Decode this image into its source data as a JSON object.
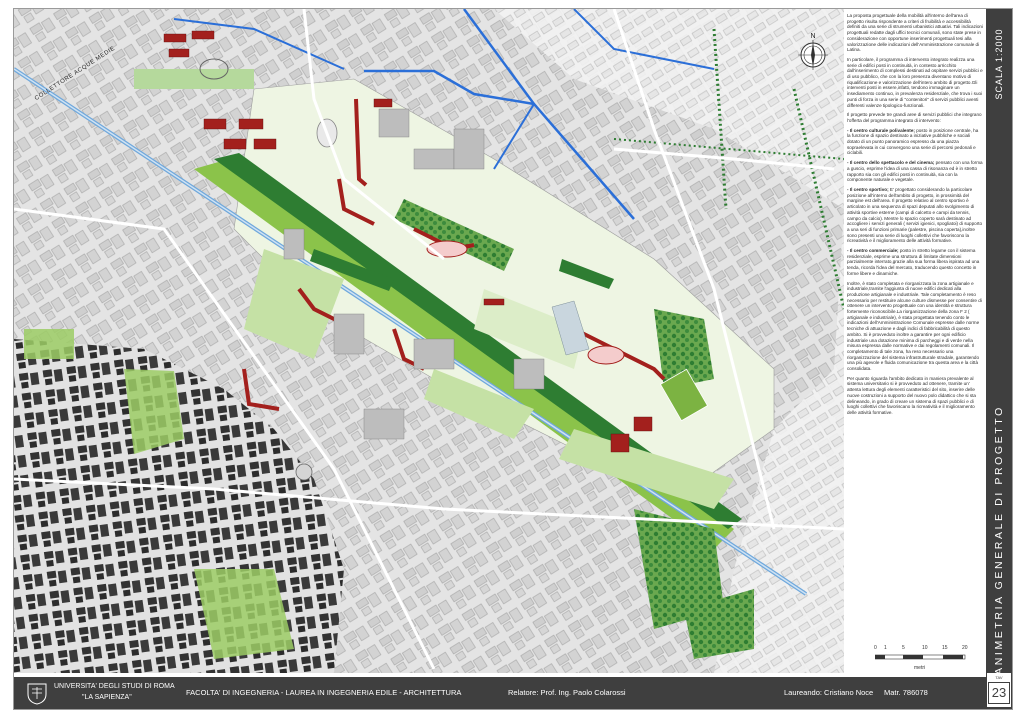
{
  "sheet": {
    "scale_label": "SCALA 1:2000",
    "title": "PLANIMETRIA GENERALE DI PROGETTO",
    "tav_label": "TAV",
    "tav_number": "23"
  },
  "map": {
    "canal_label": "COLLETTORE ACQUE MEDIE",
    "compass_letter": "N",
    "scale_ticks": [
      "0",
      "1",
      "5",
      "10",
      "15",
      "20"
    ],
    "scale_unit": "metri"
  },
  "description": {
    "p1": "La proposta progettuale della mobilità all'interno dell'area di progetto risulta rispondente a criteri di fruibilità e accessibilità definiti da una serie di strumenti urbanistici attuativi. Tali indicazioni progettuali redatte dagli uffici tecnici comunali, sono state prese in considerazione con opportune inserimenti progettuali tesi alla valorizzazione delle indicazioni dell'Amministrazione comunale di Latina.",
    "p2": "In particolare, il programma di intervento integrato realizza una serie di edifici posti in continuità, in contesto arricchito dall'inserimento di complessi destinati ad ospitare servizi pubblici e di uso pubblico, che con la loro presenza diventano motivo di riqualificazione e valorizzazione dell'intero ambito di progetto.Gli interventi posti in essere,infatti, tendono immaginare un insediamento continuo, in prevalenza residenziale, che trova i suoi punti di forza in una serie di \"contenitori\" di servizi pubblici aventi differenti valenze tipologico-funzionali.",
    "p3": "Il progetto prevede tre grandi aree di servizi pubblici che integrano l'offerta del programma integrato di intervento:",
    "b1_title": "- Il centro culturale polivalente;",
    "b1_text": "posto in posizione centrale, ha la funzione di spazio destinato a iniziative pubbliche e sociali dotato di un punto panoramico espresso da una piazza sopraelevata in cui convergono una serie di percorsi pedonali e ciclabili.",
    "b2_title": "- Il centro dello spettacolo e del cinema;",
    "b2_text": "pensato con una forma a guscio, esprime l'idea di una cassa di risonanza ed è in stretto rapporto sia con gli edifici posti in continuità, sia con la componente naturale e vegetale.",
    "b3_title": "- Il centro sportivo;",
    "b3_text": "E' progettato considerando la particolare posizione all'interno dell'ambito di progetto, in prossimità del margine est dell'area. Il progetto relativo al centro sportivo è articolato in una sequenza di spazi deputati allo svolgimento di attività sportive esterne (campi di calcetto e campi da tennis, campo da calcio). Mentre lo spazio coperto sarà destinato ad accogliere i servizi generali ( servizi igienici, spogliatoi) di supporto a una seri di funzioni primarie (palestre, piscina coperta),inoltre sono presenti una serie di luoghi collettivi che favoriscono la ricreatività e il miglioramento delle attività formative.",
    "b4_title": "- Il centro commerciale;",
    "b4_text": "posto in stretto legame con il sistema residenziale, esprime una struttura di limitate dimensioni parzialmente interrato,grazie alla sua forma libera ispirata ad una tenda, ricorda l'idea del mercato, traducendo questo concetto in forme libere e dinamiche.",
    "p4": "Inoltre, è stato completata e riorganizzata la zona artigianale e industriale,tramite l'aggiunta di nuove edifici dedicati alla produzione artigianale e industriale. Tale completamento è reso necessario per restituire alcune culture dismesse per consentire di ottenere un intervento progettuale con una identità e struttura fortemente riconoscibile.La riorganizzazione della zona F 2 ( artigianale e industriale), è stata progettata tenendo conto le indicazioni dell'Amministrazione Comunale espresse dalle norme tecniche di attuazione e dagli indici di fabbricabilità di questo ambito. Si è provveduto inoltre a garantire per ogni edificio industriale una dotazione minima di parcheggi e di verde nella misura espressa dalle normative e dai regolamenti comunali. Il completamento di tale zona, ha reso necessario una riorganizzazione del sistema infrastrutturale stradale, garantendo una più agevole e fluida comunicazione tra questa area e la città consolidata.",
    "p5": "Per quanto riguarda l'ambito dedicato in maniera prevalente al sistema universitario si è provveduto ad ottenere, tramite un' attenta lettura degli elementi caratteristici del sito, inserire delle nuove costruzioni a supporto del nuovo polo didattico che si sta delineando, in grado di creare un sistema di spazi pubblici e di luoghi collettivi che favoriscano la ricreatività e il miglioramento delle attività formative."
  },
  "footer": {
    "university_line1": "UNIVERSITA' DEGLI STUDI DI ROMA",
    "university_line2": "\"LA SAPIENZA\"",
    "faculty": "FACOLTA' DI INGEGNERIA  -  LAUREA IN INGEGNERIA EDILE - ARCHITETTURA",
    "supervisor": "Relatore: Prof. Ing. Paolo Colarossi",
    "student": "Laureando: Cristiano Noce",
    "matricola": "Matr. 786078"
  },
  "colors": {
    "footer_bg": "#3f3f3f",
    "map_bg": "#e6e6e6",
    "building_new": "#a3201d",
    "building_existing": "#bdbdbd",
    "building_dark": "#2f2f2f",
    "green_dark": "#2e7d32",
    "green_mid": "#8bc34a",
    "green_light": "#c5e1a5",
    "water": "#2b6fd8"
  }
}
